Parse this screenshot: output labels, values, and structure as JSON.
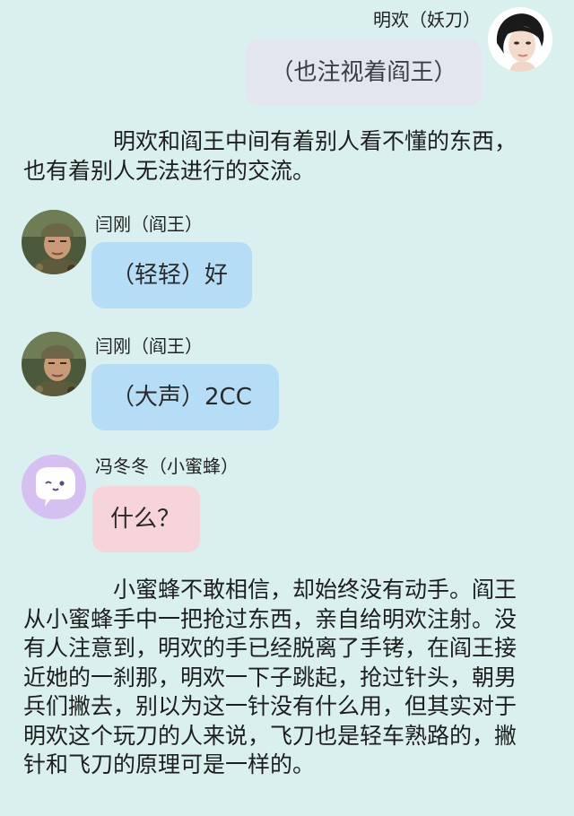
{
  "messages": [
    {
      "sender": "明欢（妖刀）",
      "text": "（也注视着阎王）",
      "side": "right",
      "bubble_color": "#e3e6ec",
      "avatar": "woman-portrait-avatar"
    },
    {
      "sender": "闫刚（阎王）",
      "text": "（轻轻）好",
      "side": "left",
      "bubble_color": "#b5ddf6",
      "avatar": "man-camo-portrait-avatar"
    },
    {
      "sender": "闫刚（阎王）",
      "text": "（大声）2CC",
      "side": "left",
      "bubble_color": "#b5ddf6",
      "avatar": "man-camo-portrait-avatar"
    },
    {
      "sender": "冯冬冬（小蜜蜂）",
      "text": "什么？",
      "side": "left",
      "bubble_color": "#f7d3da",
      "avatar": "chat-bubble-cartoon-avatar"
    }
  ],
  "narration": [
    "明欢和阎王中间有着别人看不懂的东西，也有着别人无法进行的交流。",
    "小蜜蜂不敢相信，却始终没有动手。阎王从小蜜蜂手中一把抢过东西，亲自给明欢注射。没有人注意到，明欢的手已经脱离了手铐，在阎王接近她的一刹那，明欢一下子跳起，抢过针头，朝男兵们撇去，别以为这一针没有什么用，但其实对于明欢这个玩刀的人来说，飞刀也是轻车熟路的，撇针和飞刀的原理可是一样的。"
  ],
  "colors": {
    "background": "#d9f0ef",
    "grey_bubble": "#e3e6ec",
    "blue_bubble": "#b5ddf6",
    "pink_bubble": "#f7d3da",
    "lavender_avatar": "#d6c0f2"
  }
}
